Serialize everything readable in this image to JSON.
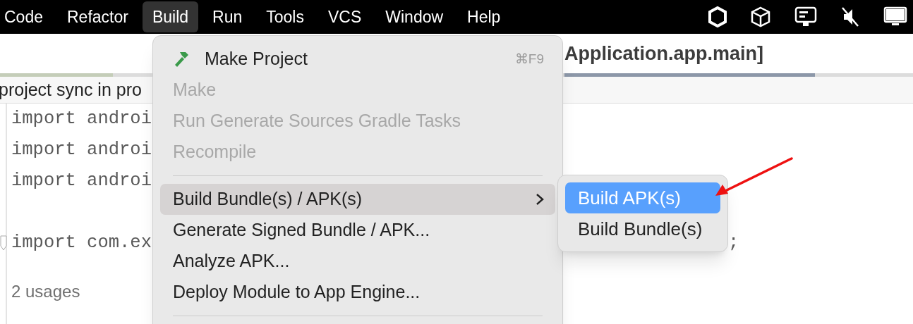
{
  "menu_bar": {
    "items": [
      {
        "label": "Code",
        "selected": false
      },
      {
        "label": "Refactor",
        "selected": false
      },
      {
        "label": "Build",
        "selected": true
      },
      {
        "label": "Run",
        "selected": false
      },
      {
        "label": "Tools",
        "selected": false
      },
      {
        "label": "VCS",
        "selected": false
      },
      {
        "label": "Window",
        "selected": false
      },
      {
        "label": "Help",
        "selected": false
      }
    ]
  },
  "window": {
    "title": "Application.app.main]"
  },
  "notification": {
    "text": "project sync in pro"
  },
  "editor": {
    "lines": [
      {
        "kind": "code",
        "text": "import androi"
      },
      {
        "kind": "code",
        "text": "import androi"
      },
      {
        "kind": "code",
        "text": "import androi"
      },
      {
        "kind": "blank"
      },
      {
        "kind": "code",
        "text": "import com.ex",
        "tail": ";",
        "fold": true
      },
      {
        "kind": "blank"
      }
    ],
    "usages": "2 usages"
  },
  "build_menu": {
    "items": [
      {
        "kind": "item",
        "label": "Make Project",
        "shortcut": "⌘F9",
        "disabled": false,
        "selected": false,
        "submenu": false
      },
      {
        "kind": "item",
        "label": "Make",
        "disabled": true,
        "selected": false,
        "submenu": false
      },
      {
        "kind": "item",
        "label": "Run Generate Sources Gradle Tasks",
        "disabled": true,
        "selected": false,
        "submenu": false
      },
      {
        "kind": "item",
        "label": "Recompile",
        "disabled": true,
        "selected": false,
        "submenu": false
      },
      {
        "kind": "separator"
      },
      {
        "kind": "item",
        "label": "Build Bundle(s) / APK(s)",
        "disabled": false,
        "selected": true,
        "submenu": true
      },
      {
        "kind": "item",
        "label": "Generate Signed Bundle / APK...",
        "disabled": false,
        "selected": false,
        "submenu": false
      },
      {
        "kind": "item",
        "label": "Analyze APK...",
        "disabled": false,
        "selected": false,
        "submenu": false
      },
      {
        "kind": "item",
        "label": "Deploy Module to App Engine...",
        "disabled": false,
        "selected": false,
        "submenu": false
      },
      {
        "kind": "separator"
      }
    ]
  },
  "submenu": {
    "items": [
      {
        "label": "Build APK(s)",
        "selected": true
      },
      {
        "label": "Build Bundle(s)",
        "selected": false
      }
    ]
  }
}
